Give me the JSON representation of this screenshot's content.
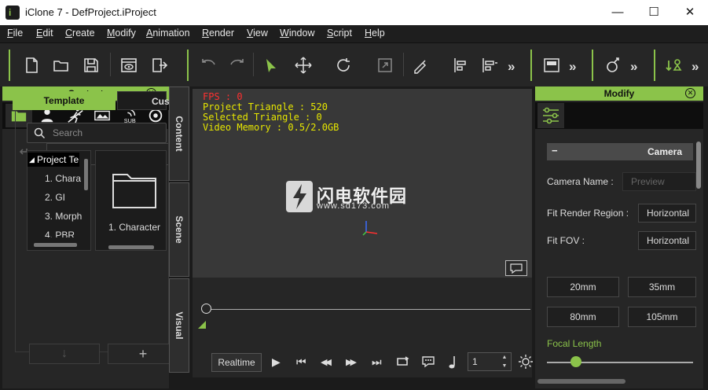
{
  "window": {
    "title": "iClone 7 - DefProject.iProject",
    "app_icon_letter": "i",
    "minimize": "—",
    "maximize": "☐",
    "close": "✕"
  },
  "menu": [
    "File",
    "Edit",
    "Create",
    "Modify",
    "Animation",
    "Render",
    "View",
    "Window",
    "Script",
    "Help"
  ],
  "toolbar": {
    "more": "»"
  },
  "content_panel": {
    "title": "Content",
    "template_tab": "Template",
    "custom_tab": "Cus",
    "search_placeholder": "Search",
    "tree": [
      "Project Te",
      "1. Chara",
      "2. GI",
      "3. Morph",
      "4. PBR"
    ],
    "thumb_label": "1. Character",
    "down_btn": "↓",
    "add_btn": "+"
  },
  "side_tabs": [
    "Content",
    "Scene",
    "Visual"
  ],
  "viewport": {
    "fps": "FPS : 0",
    "project_triangle": "Project Triangle : 520",
    "selected_triangle": "Selected Triangle : 0",
    "video_memory": "Video Memory : 0.5/2.0GB",
    "watermark_text": "闪电软件园",
    "watermark_url": "www.sd173.com"
  },
  "playbar": {
    "realtime": "Realtime",
    "play": "▶",
    "first": "⏮",
    "prev": "◀◀",
    "next": "▶▶",
    "last": "⏭",
    "frame": "1"
  },
  "modify_panel": {
    "title": "Modify",
    "section": "Camera",
    "collapse": "−",
    "camera_name_label": "Camera Name :",
    "camera_name_placeholder": "Preview",
    "fit_render_label": "Fit Render Region :",
    "fit_render_value": "Horizontal",
    "fit_fov_label": "Fit FOV :",
    "fit_fov_value": "Horizontal",
    "lenses": [
      "20mm",
      "35mm",
      "80mm",
      "105mm"
    ],
    "focal_length_label": "Focal Length",
    "focal_length_fraction": 0.2
  },
  "colors": {
    "accent": "#8bc34a",
    "stat_text": "#e6e600",
    "fps_text": "#ff3030"
  }
}
